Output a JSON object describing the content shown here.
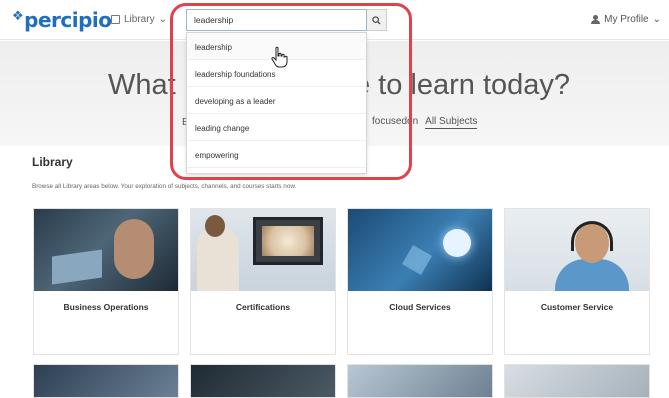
{
  "header": {
    "logo": "percipio",
    "library_menu": "Library",
    "search_value": "leadership",
    "profile": "My Profile"
  },
  "search_suggestions": [
    "leadership",
    "leadership foundations",
    "developing as a leader",
    "leading change",
    "empowering"
  ],
  "hero": {
    "question_left": "What",
    "question_right": "e to learn today?",
    "fragment": "E",
    "links": [
      "focusedon",
      "All Subjects"
    ]
  },
  "library": {
    "title": "Library",
    "description": "Browse all Library areas below. Your exploration of subjects, channels, and courses starts now.",
    "cards": [
      {
        "label": "Business Operations"
      },
      {
        "label": "Certifications"
      },
      {
        "label": "Cloud Services"
      },
      {
        "label": "Customer Service"
      }
    ]
  },
  "colors": {
    "brand": "#1f6ec0",
    "highlight": "#e0424b"
  },
  "icons": {
    "library": "book-icon",
    "search": "search-icon",
    "profile": "user-icon",
    "cursor": "hand-pointer-icon"
  }
}
